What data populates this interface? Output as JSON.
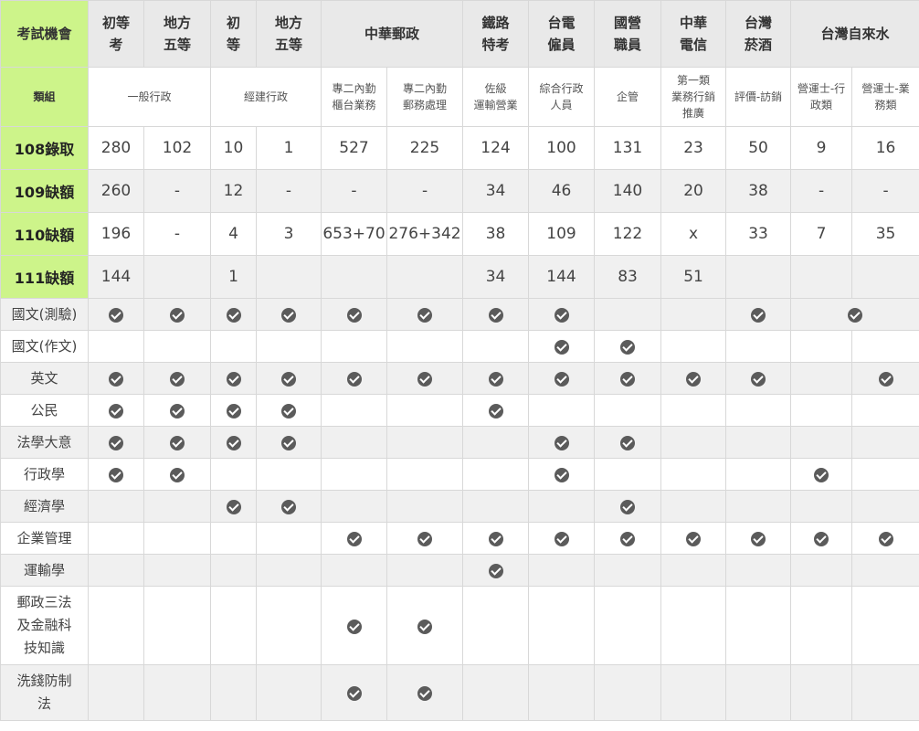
{
  "header": {
    "title": "考試機會",
    "cols": [
      "初等\n考",
      "地方\n五等",
      "初\n等",
      "地方\n五等",
      "中華郵政",
      "鐵路\n特考",
      "台電\n僱員",
      "國營\n職員",
      "中華\n電信",
      "台灣\n菸酒",
      "台灣自來水"
    ]
  },
  "group": {
    "title": "類組",
    "cells": [
      "一般行政",
      "經建行政",
      "專二內勤\n櫃台業務",
      "專二內勤\n郵務處理",
      "佐級\n運輸營業",
      "綜合行政\n人員",
      "企管",
      "第一類\n業務行銷\n推廣",
      "評價-訪銷",
      "營運士-行\n政類",
      "營運士-業\n務類"
    ]
  },
  "rows": [
    {
      "label": "108錄取",
      "values": [
        "280",
        "102",
        "10",
        "1",
        "527",
        "225",
        "124",
        "100",
        "131",
        "23",
        "50",
        "9",
        "16"
      ]
    },
    {
      "label": "109缺額",
      "values": [
        "260",
        "-",
        "12",
        "-",
        "-",
        "-",
        "34",
        "46",
        "140",
        "20",
        "38",
        "-",
        "-"
      ]
    },
    {
      "label": "110缺額",
      "values": [
        "196",
        "-",
        "4",
        "3",
        "653+70",
        "276+342",
        "38",
        "109",
        "122",
        "x",
        "33",
        "7",
        "35"
      ]
    },
    {
      "label": "111缺額",
      "values": [
        "144",
        "",
        "1",
        "",
        "",
        "",
        "34",
        "144",
        "83",
        "51",
        "",
        "",
        ""
      ]
    }
  ],
  "subjects": [
    {
      "label": "國文(測驗)",
      "checks": [
        1,
        1,
        1,
        1,
        1,
        1,
        1,
        1,
        0,
        0,
        1,
        "span",
        0
      ]
    },
    {
      "label": "國文(作文)",
      "checks": [
        0,
        0,
        0,
        0,
        0,
        0,
        0,
        1,
        1,
        0,
        0,
        0,
        0
      ]
    },
    {
      "label": "英文",
      "checks": [
        1,
        1,
        1,
        1,
        1,
        1,
        1,
        1,
        1,
        1,
        1,
        0,
        1
      ]
    },
    {
      "label": "公民",
      "checks": [
        1,
        1,
        1,
        1,
        0,
        0,
        1,
        0,
        0,
        0,
        0,
        0,
        0
      ]
    },
    {
      "label": "法學大意",
      "checks": [
        1,
        1,
        1,
        1,
        0,
        0,
        0,
        1,
        1,
        0,
        0,
        0,
        0
      ]
    },
    {
      "label": "行政學",
      "checks": [
        1,
        1,
        0,
        0,
        0,
        0,
        0,
        1,
        0,
        0,
        0,
        1,
        0
      ]
    },
    {
      "label": "經濟學",
      "checks": [
        0,
        0,
        1,
        1,
        0,
        0,
        0,
        0,
        1,
        0,
        0,
        0,
        0
      ]
    },
    {
      "label": "企業管理",
      "checks": [
        0,
        0,
        0,
        0,
        1,
        1,
        1,
        1,
        1,
        1,
        1,
        1,
        1
      ]
    },
    {
      "label": "運輸學",
      "checks": [
        0,
        0,
        0,
        0,
        0,
        0,
        1,
        0,
        0,
        0,
        0,
        0,
        0
      ]
    },
    {
      "label": "郵政三法\n及金融科\n技知識",
      "checks": [
        0,
        0,
        0,
        0,
        1,
        1,
        0,
        0,
        0,
        0,
        0,
        0,
        0
      ]
    },
    {
      "label": "洗錢防制\n法",
      "checks": [
        0,
        0,
        0,
        0,
        1,
        1,
        0,
        0,
        0,
        0,
        0,
        0,
        0
      ]
    }
  ]
}
